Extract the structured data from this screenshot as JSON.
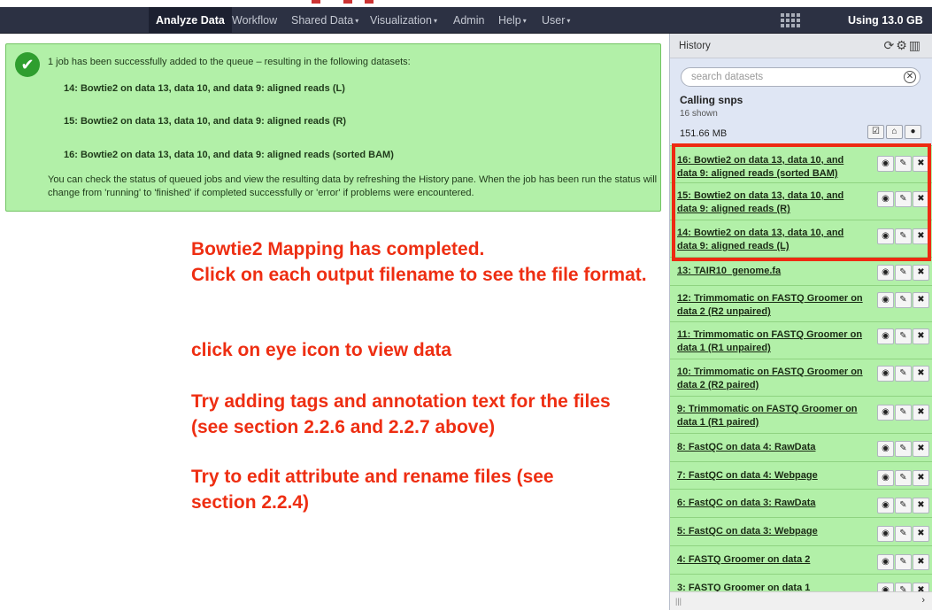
{
  "navbar": {
    "items": [
      {
        "label": "Analyze Data",
        "caret": false,
        "active": true
      },
      {
        "label": "Workflow",
        "caret": false,
        "active": false
      },
      {
        "label": "Shared Data",
        "caret": true,
        "active": false
      },
      {
        "label": "Visualization",
        "caret": true,
        "active": false
      },
      {
        "label": "Admin",
        "caret": false,
        "active": false
      },
      {
        "label": "Help",
        "caret": true,
        "active": false
      },
      {
        "label": "User",
        "caret": true,
        "active": false
      }
    ],
    "usage": "Using 13.0 GB"
  },
  "message": {
    "intro": "1 job has been successfully added to the queue – resulting in the following datasets:",
    "datasets": [
      "14: Bowtie2 on data 13, data 10, and data 9: aligned reads (L)",
      "15: Bowtie2 on data 13, data 10, and data 9: aligned reads (R)",
      "16: Bowtie2 on data 13, data 10, and data 9: aligned reads (sorted BAM)"
    ],
    "footer": "You can check the status of queued jobs and view the resulting data by refreshing the History pane. When the job has been run the status will change from 'running' to 'finished' if completed successfully or 'error' if problems were encountered."
  },
  "annotation": {
    "lines": [
      "Bowtie2 Mapping has completed.",
      "Click on each output filename to see the file format.",
      "click on eye icon to view data",
      "Try adding tags and annotation text for the files (see section 2.2.6 and 2.2.7 above)",
      "Try to edit attribute and rename files (see section 2.2.4)"
    ],
    "color": "#ee2e12"
  },
  "history": {
    "title": "History",
    "search_placeholder": "search datasets",
    "name": "Calling snps",
    "shown": "16 shown",
    "size": "151.66 MB",
    "items": [
      "16: Bowtie2 on data 13, data 10, and data 9: aligned reads (sorted BAM)",
      "15: Bowtie2 on data 13, data 10, and data 9: aligned reads (R)",
      "14: Bowtie2 on data 13, data 10, and data 9: aligned reads (L)",
      "13: TAIR10_genome.fa",
      "12: Trimmomatic on FASTQ Groomer on data 2 (R2 unpaired)",
      "11: Trimmomatic on FASTQ Groomer on data 1 (R1 unpaired)",
      "10: Trimmomatic on FASTQ Groomer on data 2 (R2 paired)",
      "9: Trimmomatic on FASTQ Groomer on data 1 (R1 paired)",
      "8: FastQC on data 4: RawData",
      "7: FastQC on data 4: Webpage",
      "6: FastQC on data 3: RawData",
      "5: FastQC on data 3: Webpage",
      "4: FASTQ Groomer on data 2",
      "3: FASTQ Groomer on data 1"
    ]
  },
  "colors": {
    "navbar_bg": "#2c3143",
    "ok_green": "#b2f0a8",
    "highlight_red": "#ee2a12"
  }
}
